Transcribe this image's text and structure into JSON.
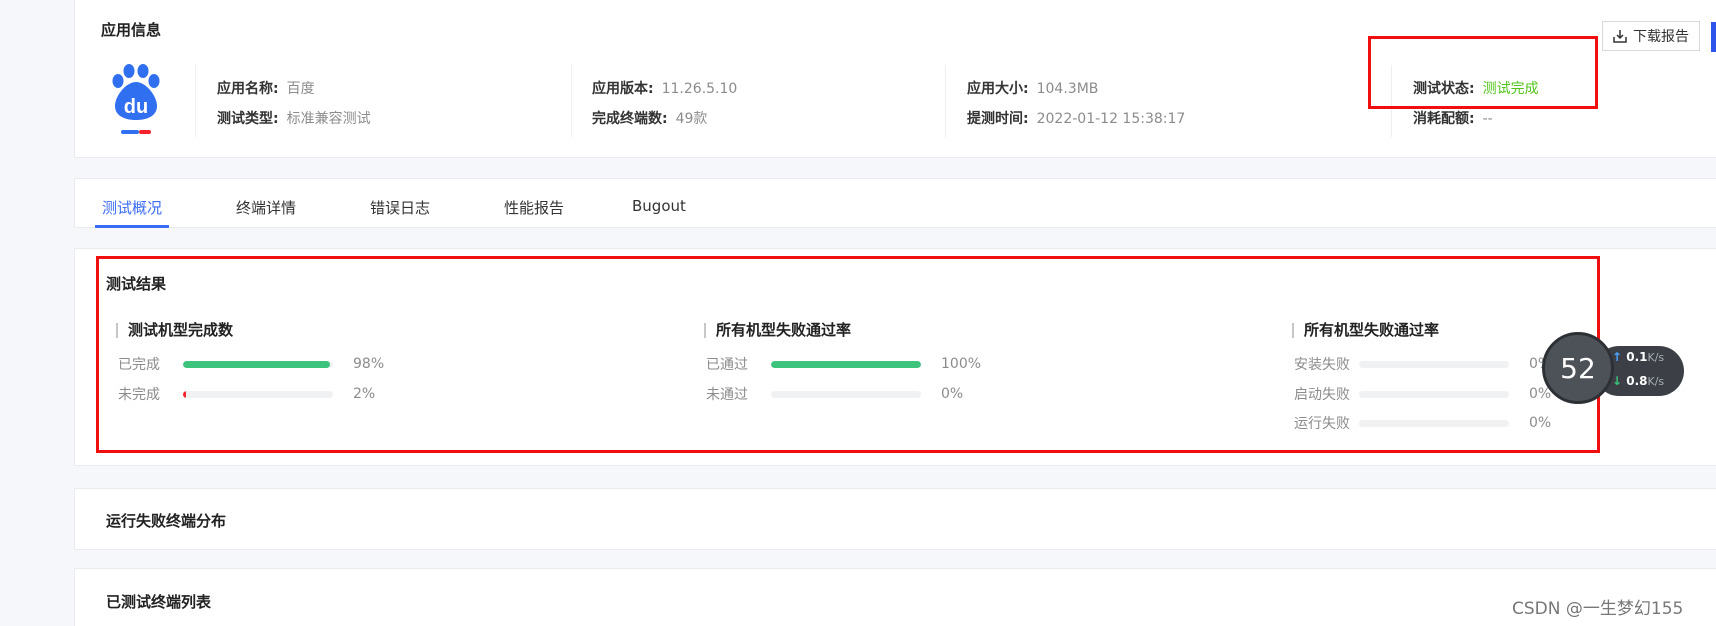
{
  "app_info": {
    "title": "应用信息",
    "download_label": "下载报告",
    "fields": {
      "name_key": "应用名称:",
      "name_val": "百度",
      "type_key": "测试类型:",
      "type_val": "标准兼容测试",
      "version_key": "应用版本:",
      "version_val": "11.26.5.10",
      "devices_key": "完成终端数:",
      "devices_val": "49款",
      "size_key": "应用大小:",
      "size_val": "104.3MB",
      "time_key": "提测时间:",
      "time_val": "2022-01-12 15:38:17",
      "status_key": "测试状态:",
      "status_val": "测试完成",
      "quota_key": "消耗配额:",
      "quota_val": "--"
    }
  },
  "tabs": [
    "测试概况",
    "终端详情",
    "错误日志",
    "性能报告",
    "Bugout"
  ],
  "results": {
    "title": "测试结果",
    "groups": [
      {
        "title": "测试机型完成数",
        "rows": [
          {
            "label": "已完成",
            "pct_text": "98%",
            "fill": 0.98,
            "color": "#3cc47c"
          },
          {
            "label": "未完成",
            "pct_text": "2%",
            "fill": 0.02,
            "color": "#f5222d"
          }
        ]
      },
      {
        "title": "所有机型失败通过率",
        "rows": [
          {
            "label": "已通过",
            "pct_text": "100%",
            "fill": 1.0,
            "color": "#3cc47c"
          },
          {
            "label": "未通过",
            "pct_text": "0%",
            "fill": 0,
            "color": "#f5222d"
          }
        ]
      },
      {
        "title": "所有机型失败通过率",
        "rows": [
          {
            "label": "安装失败",
            "pct_text": "0%",
            "fill": 0,
            "color": "#f5222d"
          },
          {
            "label": "启动失败",
            "pct_text": "0%",
            "fill": 0,
            "color": "#f5222d"
          },
          {
            "label": "运行失败",
            "pct_text": "0%",
            "fill": 0,
            "color": "#f5222d"
          }
        ]
      }
    ]
  },
  "fail_distribution": {
    "title": "运行失败终端分布"
  },
  "tested_list": {
    "title": "已测试终端列表"
  },
  "speed_widget": {
    "value": "52",
    "up": "0.1",
    "down": "0.8",
    "unit": "K/s"
  },
  "watermark": "CSDN @一生梦幻155",
  "colors": {
    "accent": "#3b6cf5",
    "success": "#52c41a",
    "bar_green": "#3cc47c",
    "highlight": "#f00e0e"
  }
}
